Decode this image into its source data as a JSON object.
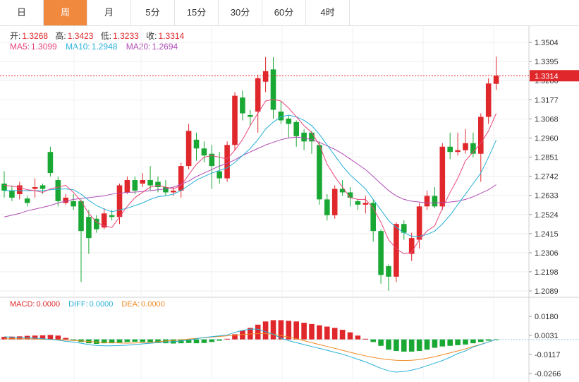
{
  "tabs": [
    {
      "label": "日",
      "active": false
    },
    {
      "label": "周",
      "active": true
    },
    {
      "label": "月",
      "active": false
    },
    {
      "label": "5分",
      "active": false
    },
    {
      "label": "15分",
      "active": false
    },
    {
      "label": "30分",
      "active": false
    },
    {
      "label": "60分",
      "active": false
    },
    {
      "label": "4时",
      "active": false
    }
  ],
  "ohlc": {
    "open_label": "开:",
    "open": "1.3268",
    "high_label": "高:",
    "high": "1.3423",
    "low_label": "低:",
    "low": "1.3233",
    "close_label": "收:",
    "close": "1.3314"
  },
  "ma": {
    "ma5_label": "MA5:",
    "ma5": "1.3099",
    "ma10_label": "MA10:",
    "ma10": "1.2948",
    "ma20_label": "MA20:",
    "ma20": "1.2694"
  },
  "macd_info": {
    "macd_label": "MACD:",
    "macd": "0.0000",
    "diff_label": "DIFF:",
    "diff": "0.0000",
    "dea_label": "DEA:",
    "dea": "0.0000"
  },
  "colors": {
    "up": "#e0272b",
    "down": "#1aa834",
    "ma5": "#e8467a",
    "ma10": "#27b0d8",
    "ma20": "#b04bb6",
    "dea": "#f08a24",
    "diff": "#27b0d8",
    "accent": "#f0883e"
  },
  "chart_data": [
    {
      "type": "candlestick",
      "price_axis_ticks": [
        "1.3504",
        "1.3395",
        "1.3286",
        "1.3177",
        "1.3068",
        "1.2960",
        "1.2851",
        "1.2742",
        "1.2633",
        "1.2524",
        "1.2415",
        "1.2306",
        "1.2198",
        "1.2089"
      ],
      "ylim": [
        1.205,
        1.356
      ],
      "last_price": "1.3314",
      "candles": [
        [
          1.27,
          1.266,
          1.277,
          1.262
        ],
        [
          1.266,
          1.262,
          1.269,
          1.26
        ],
        [
          1.264,
          1.269,
          1.271,
          1.261
        ],
        [
          1.2615,
          1.259,
          1.263,
          1.257
        ],
        [
          1.267,
          1.268,
          1.273,
          1.262
        ],
        [
          1.269,
          1.267,
          1.27,
          1.264
        ],
        [
          1.288,
          1.276,
          1.291,
          1.274
        ],
        [
          1.272,
          1.26,
          1.274,
          1.257
        ],
        [
          1.259,
          1.262,
          1.264,
          1.258
        ],
        [
          1.26,
          1.257,
          1.264,
          1.255
        ],
        [
          1.26,
          1.243,
          1.261,
          1.214
        ],
        [
          1.251,
          1.239,
          1.255,
          1.23
        ],
        [
          1.25,
          1.244,
          1.252,
          1.242
        ],
        [
          1.245,
          1.253,
          1.256,
          1.244
        ],
        [
          1.252,
          1.251,
          1.255,
          1.249
        ],
        [
          1.251,
          1.269,
          1.27,
          1.247
        ],
        [
          1.265,
          1.272,
          1.274,
          1.264
        ],
        [
          1.272,
          1.266,
          1.274,
          1.264
        ],
        [
          1.27,
          1.272,
          1.276,
          1.268
        ],
        [
          1.272,
          1.269,
          1.28,
          1.266
        ],
        [
          1.271,
          1.268,
          1.274,
          1.265
        ],
        [
          1.268,
          1.265,
          1.272,
          1.263
        ],
        [
          1.265,
          1.266,
          1.268,
          1.263
        ],
        [
          1.266,
          1.28,
          1.282,
          1.262
        ],
        [
          1.28,
          1.3,
          1.304,
          1.278
        ],
        [
          1.295,
          1.29,
          1.299,
          1.283
        ],
        [
          1.29,
          1.286,
          1.294,
          1.282
        ],
        [
          1.287,
          1.28,
          1.292,
          1.267
        ],
        [
          1.277,
          1.273,
          1.288,
          1.27
        ],
        [
          1.273,
          1.292,
          1.294,
          1.271
        ],
        [
          1.292,
          1.32,
          1.322,
          1.289
        ],
        [
          1.319,
          1.31,
          1.323,
          1.306
        ],
        [
          1.309,
          1.308,
          1.312,
          1.303
        ],
        [
          1.311,
          1.33,
          1.332,
          1.299
        ],
        [
          1.328,
          1.334,
          1.342,
          1.322
        ],
        [
          1.335,
          1.312,
          1.342,
          1.307
        ],
        [
          1.311,
          1.306,
          1.317,
          1.304
        ],
        [
          1.307,
          1.304,
          1.309,
          1.296
        ],
        [
          1.305,
          1.297,
          1.306,
          1.291
        ],
        [
          1.299,
          1.294,
          1.301,
          1.289
        ],
        [
          1.299,
          1.294,
          1.3,
          1.287
        ],
        [
          1.292,
          1.261,
          1.294,
          1.258
        ],
        [
          1.261,
          1.252,
          1.264,
          1.249
        ],
        [
          1.252,
          1.267,
          1.269,
          1.25
        ],
        [
          1.267,
          1.265,
          1.272,
          1.263
        ],
        [
          1.265,
          1.262,
          1.268,
          1.257
        ],
        [
          1.26,
          1.258,
          1.261,
          1.255
        ],
        [
          1.258,
          1.259,
          1.263,
          1.253
        ],
        [
          1.259,
          1.243,
          1.261,
          1.237
        ],
        [
          1.243,
          1.218,
          1.244,
          1.213
        ],
        [
          1.223,
          1.217,
          1.224,
          1.209
        ],
        [
          1.217,
          1.247,
          1.248,
          1.214
        ],
        [
          1.247,
          1.242,
          1.249,
          1.238
        ],
        [
          1.23,
          1.239,
          1.242,
          1.226
        ],
        [
          1.238,
          1.257,
          1.259,
          1.233
        ],
        [
          1.257,
          1.263,
          1.266,
          1.255
        ],
        [
          1.263,
          1.257,
          1.268,
          1.256
        ],
        [
          1.257,
          1.291,
          1.293,
          1.255
        ],
        [
          1.291,
          1.288,
          1.299,
          1.284
        ],
        [
          1.288,
          1.289,
          1.299,
          1.286
        ],
        [
          1.289,
          1.293,
          1.301,
          1.287
        ],
        [
          1.293,
          1.287,
          1.299,
          1.285
        ],
        [
          1.287,
          1.308,
          1.31,
          1.271
        ],
        [
          1.308,
          1.327,
          1.33,
          1.304
        ],
        [
          1.3268,
          1.3314,
          1.3423,
          1.3233
        ]
      ],
      "ma5": [
        1.269,
        1.2685,
        1.2678,
        1.2665,
        1.266,
        1.265,
        1.267,
        1.268,
        1.269,
        1.265,
        1.26,
        1.253,
        1.248,
        1.246,
        1.245,
        1.251,
        1.257,
        1.262,
        1.265,
        1.268,
        1.269,
        1.268,
        1.267,
        1.269,
        1.275,
        1.281,
        1.285,
        1.286,
        1.285,
        1.284,
        1.289,
        1.295,
        1.303,
        1.31,
        1.317,
        1.318,
        1.317,
        1.313,
        1.308,
        1.303,
        1.299,
        1.292,
        1.281,
        1.274,
        1.268,
        1.262,
        1.261,
        1.261,
        1.256,
        1.248,
        1.238,
        1.233,
        1.23,
        1.231,
        1.238,
        1.243,
        1.246,
        1.256,
        1.265,
        1.273,
        1.283,
        1.288,
        1.293,
        1.3,
        1.3099
      ],
      "ma10": [
        1.266,
        1.266,
        1.266,
        1.266,
        1.266,
        1.266,
        1.2665,
        1.2668,
        1.267,
        1.2665,
        1.264,
        1.2605,
        1.2575,
        1.2555,
        1.254,
        1.255,
        1.256,
        1.2575,
        1.259,
        1.261,
        1.2625,
        1.263,
        1.264,
        1.266,
        1.269,
        1.272,
        1.274,
        1.276,
        1.2775,
        1.279,
        1.282,
        1.286,
        1.29,
        1.295,
        1.301,
        1.305,
        1.308,
        1.309,
        1.308,
        1.306,
        1.303,
        1.298,
        1.292,
        1.286,
        1.28,
        1.275,
        1.271,
        1.267,
        1.261,
        1.255,
        1.249,
        1.245,
        1.242,
        1.24,
        1.24,
        1.241,
        1.243,
        1.247,
        1.252,
        1.258,
        1.264,
        1.27,
        1.276,
        1.285,
        1.2948
      ],
      "ma20": [
        1.251,
        1.252,
        1.253,
        1.2545,
        1.2555,
        1.2565,
        1.2575,
        1.259,
        1.26,
        1.261,
        1.2615,
        1.262,
        1.2625,
        1.263,
        1.264,
        1.2645,
        1.265,
        1.2652,
        1.2655,
        1.266,
        1.2665,
        1.267,
        1.268,
        1.2695,
        1.2715,
        1.274,
        1.276,
        1.278,
        1.28,
        1.2815,
        1.2835,
        1.286,
        1.288,
        1.29,
        1.292,
        1.2935,
        1.295,
        1.296,
        1.2965,
        1.296,
        1.295,
        1.2935,
        1.2915,
        1.2895,
        1.287,
        1.284,
        1.281,
        1.278,
        1.274,
        1.27,
        1.266,
        1.263,
        1.261,
        1.26,
        1.2595,
        1.259,
        1.259,
        1.2592,
        1.2595,
        1.26,
        1.261,
        1.2625,
        1.2645,
        1.2665,
        1.2694
      ]
    },
    {
      "type": "macd",
      "axis_ticks": [
        "0.0180",
        "0.0031",
        "-0.0117",
        "-0.0266"
      ],
      "ylim": [
        -0.03,
        0.0215
      ],
      "hist": [
        0.002,
        0.0022,
        0.0024,
        0.0028,
        0.003,
        0.0032,
        0.0035,
        0.003,
        0.0012,
        -0.001,
        -0.002,
        -0.003,
        -0.0035,
        -0.003,
        -0.003,
        -0.0025,
        -0.002,
        -0.0018,
        -0.002,
        -0.0025,
        -0.0028,
        -0.003,
        -0.0032,
        -0.003,
        -0.0028,
        -0.003,
        -0.0028,
        -0.002,
        -0.001,
        0.0005,
        0.004,
        0.007,
        0.009,
        0.0115,
        0.014,
        0.015,
        0.015,
        0.0145,
        0.014,
        0.013,
        0.012,
        0.011,
        0.01,
        0.009,
        0.0075,
        0.0055,
        0.003,
        0.0005,
        -0.002,
        -0.005,
        -0.008,
        -0.009,
        -0.0095,
        -0.0095,
        -0.009,
        -0.008,
        -0.0065,
        -0.0055,
        -0.005,
        -0.0045,
        -0.004,
        -0.003,
        -0.002,
        -0.001,
        -0.0005
      ],
      "diff": [
        0.002,
        0.0018,
        0.0015,
        0.0012,
        0.001,
        0.0005,
        0.0,
        -0.0005,
        -0.0015,
        -0.002,
        -0.003,
        -0.004,
        -0.0048,
        -0.005,
        -0.005,
        -0.0048,
        -0.0045,
        -0.004,
        -0.0035,
        -0.003,
        -0.0025,
        -0.002,
        -0.0018,
        -0.0012,
        -0.0005,
        0.0005,
        0.0015,
        0.0022,
        0.0028,
        0.0035,
        0.0055,
        0.007,
        0.008,
        0.008,
        0.006,
        0.004,
        0.001,
        -0.001,
        -0.0025,
        -0.004,
        -0.0055,
        -0.007,
        -0.0085,
        -0.01,
        -0.0115,
        -0.0135,
        -0.0155,
        -0.0175,
        -0.02,
        -0.0225,
        -0.0245,
        -0.0255,
        -0.025,
        -0.024,
        -0.0225,
        -0.0205,
        -0.0185,
        -0.0165,
        -0.014,
        -0.011,
        -0.009,
        -0.006,
        -0.004,
        -0.002,
        0.0
      ],
      "dea": [
        0.0005,
        0.0005,
        0.0005,
        0.0004,
        0.0003,
        0.0002,
        0.0,
        -0.0002,
        -0.0005,
        -0.0008,
        -0.0012,
        -0.0016,
        -0.002,
        -0.0023,
        -0.0026,
        -0.0028,
        -0.0029,
        -0.0028,
        -0.0026,
        -0.0022,
        -0.0018,
        -0.0013,
        -0.0008,
        -0.0003,
        0.0003,
        0.0008,
        0.0013,
        0.0018,
        0.0023,
        0.0028,
        0.0033,
        0.0038,
        0.0042,
        0.0045,
        0.0045,
        0.004,
        0.003,
        0.0018,
        0.0005,
        -0.001,
        -0.0025,
        -0.004,
        -0.0055,
        -0.007,
        -0.0085,
        -0.01,
        -0.0115,
        -0.0128,
        -0.014,
        -0.015,
        -0.0158,
        -0.0163,
        -0.0165,
        -0.0163,
        -0.0157,
        -0.0147,
        -0.0135,
        -0.012,
        -0.0105,
        -0.009,
        -0.0074,
        -0.0055,
        -0.0038,
        -0.002,
        0.0
      ]
    }
  ]
}
